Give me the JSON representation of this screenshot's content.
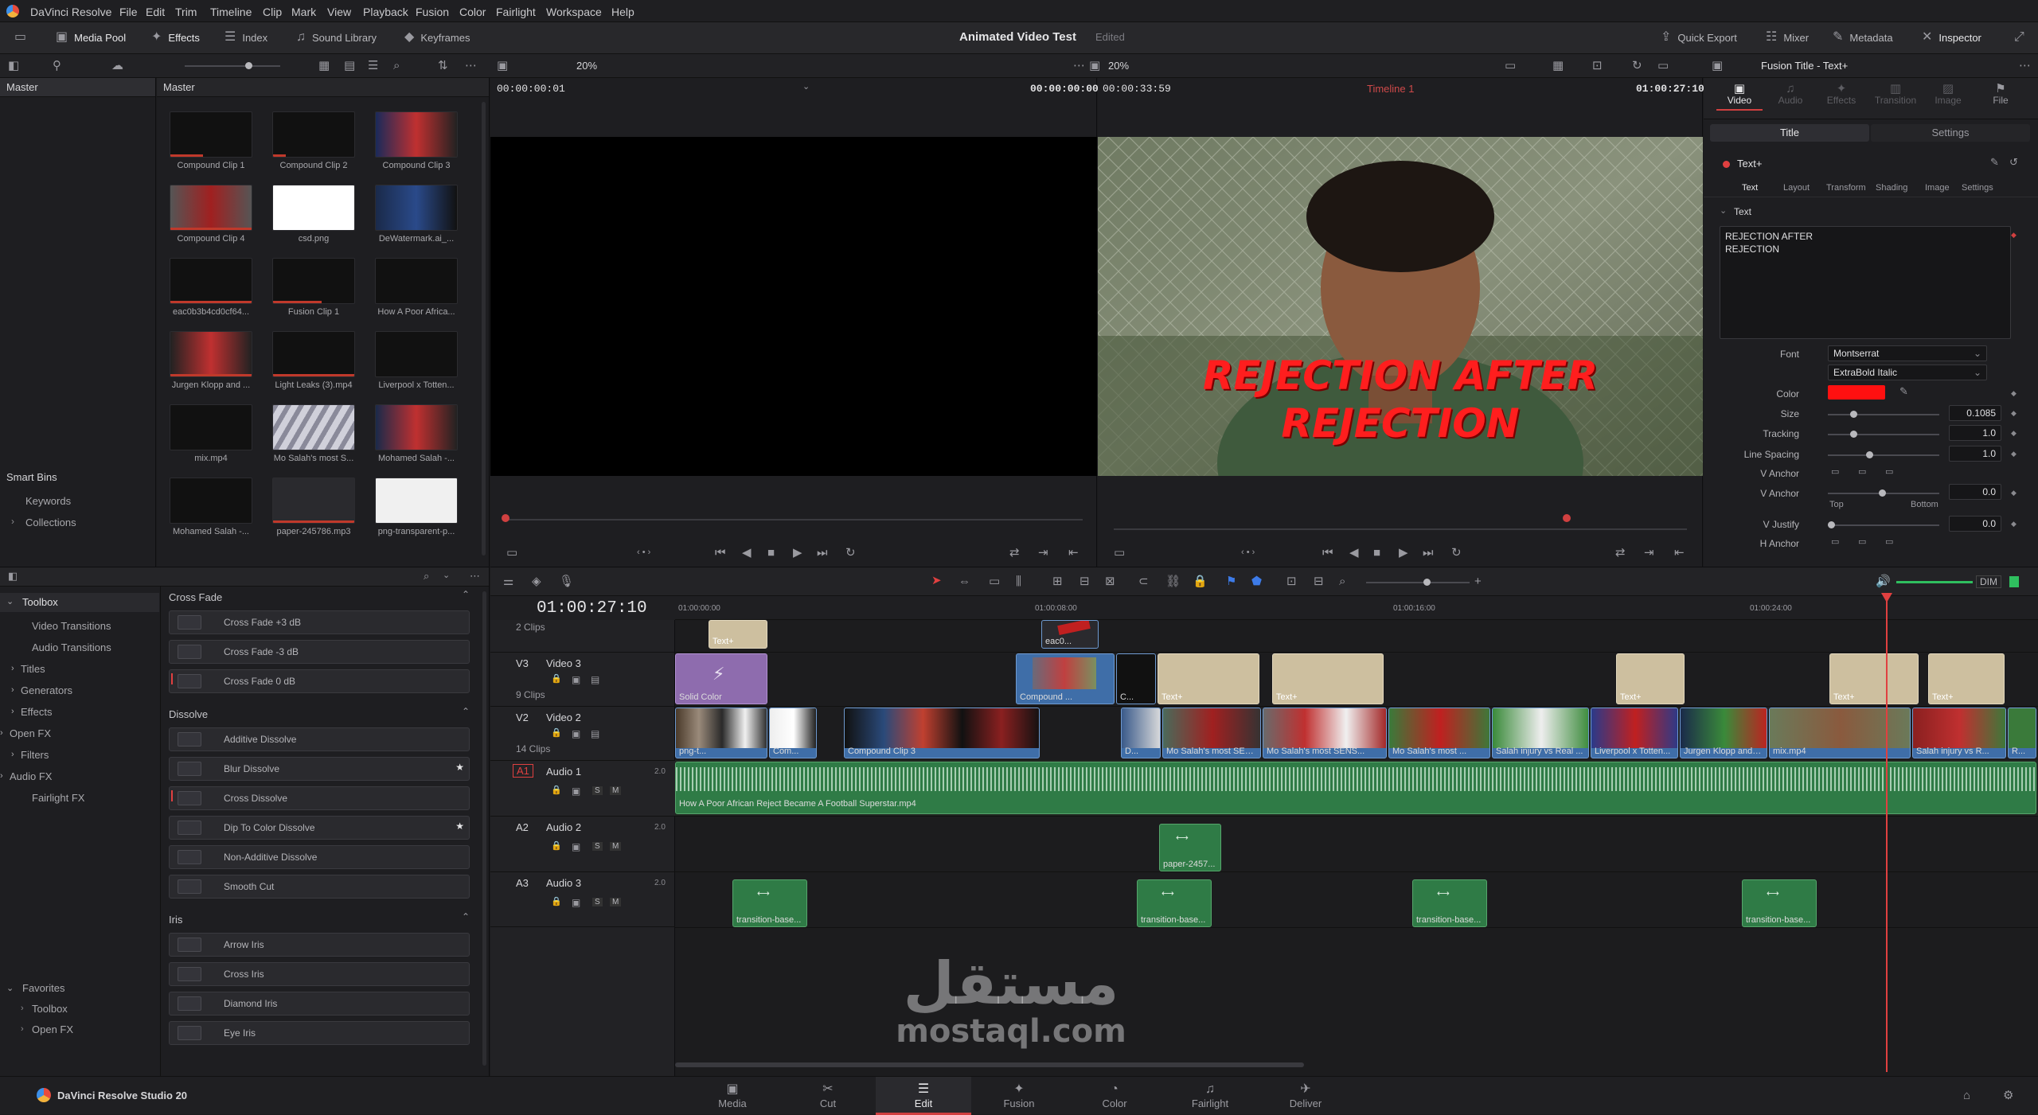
{
  "menu": {
    "app": "DaVinci Resolve",
    "items": [
      "File",
      "Edit",
      "Trim",
      "Timeline",
      "Clip",
      "Mark",
      "View",
      "Playback",
      "Fusion",
      "Color",
      "Fairlight",
      "Workspace",
      "Help"
    ]
  },
  "toolbar": {
    "media_pool": "Media Pool",
    "effects": "Effects",
    "index": "Index",
    "sound_library": "Sound Library",
    "keyframes": "Keyframes",
    "project_title": "Animated Video Test",
    "project_status": "Edited",
    "quick_export": "Quick Export",
    "mixer": "Mixer",
    "metadata": "Metadata",
    "inspector": "Inspector"
  },
  "subbar": {
    "zoom_left": "20%",
    "zoom_right": "20%",
    "inspector_title": "Fusion Title - Text+"
  },
  "bins": {
    "master_left": "Master",
    "master_right": "Master",
    "smart_bins": "Smart Bins",
    "keywords": "Keywords",
    "collections": "Collections"
  },
  "media_pool": {
    "clips": [
      "Compound Clip 1",
      "Compound Clip 2",
      "Compound Clip 3",
      "Compound Clip 4",
      "csd.png",
      "DeWatermark.ai_...",
      "eac0b3b4cd0cf64...",
      "Fusion Clip 1",
      "How A Poor Africa...",
      "Jurgen Klopp and ...",
      "Light Leaks (3).mp4",
      "Liverpool x Totten...",
      "mix.mp4",
      "Mo Salah's most S...",
      "Mohamed Salah -...",
      "Mohamed Salah -...",
      "paper-245786.mp3",
      "png-transparent-p..."
    ]
  },
  "source_viewer": {
    "timecode_left": "00:00:00:01",
    "timecode_right": "00:00:00:00"
  },
  "timeline_viewer": {
    "timecode_left": "00:00:33:59",
    "timeline_name": "Timeline 1",
    "timecode_right": "01:00:27:10",
    "title_line1": "REJECTION AFTER",
    "title_line2": "REJECTION"
  },
  "inspector": {
    "tabs": [
      "Video",
      "Audio",
      "Effects",
      "Transition",
      "Image",
      "File"
    ],
    "subtabs": [
      "Title",
      "Settings"
    ],
    "node": "Text+",
    "text_tabs": [
      "Text",
      "Layout",
      "Transform",
      "Shading",
      "Image",
      "Settings"
    ],
    "section": "Text",
    "text_value_line1": "REJECTION AFTER",
    "text_value_line2": "REJECTION",
    "font_label": "Font",
    "font": "Montserrat",
    "style": "ExtraBold Italic",
    "color_label": "Color",
    "color": "#ff1010",
    "size_label": "Size",
    "size": "0.1085",
    "tracking_label": "Tracking",
    "tracking": "1.0",
    "line_spacing_label": "Line Spacing",
    "line_spacing": "1.0",
    "v_anchor_label": "V Anchor",
    "v_anchor2_label": "V Anchor",
    "v_anchor_value": "0.0",
    "top_label": "Top",
    "bottom_label": "Bottom",
    "v_justify_label": "V Justify",
    "v_justify_value": "0.0",
    "h_anchor_label": "H Anchor"
  },
  "effects": {
    "toolbox": "Toolbox",
    "tree": [
      "Video Transitions",
      "Audio Transitions",
      "Titles",
      "Generators",
      "Effects",
      "Open FX",
      "Filters",
      "Audio FX",
      "Fairlight FX"
    ],
    "favorites": "Favorites",
    "fav_items": [
      "Toolbox",
      "Open FX"
    ],
    "sections": [
      {
        "title": "Cross Fade",
        "items": [
          "Cross Fade +3 dB",
          "Cross Fade -3 dB",
          "Cross Fade 0 dB"
        ]
      },
      {
        "title": "Dissolve",
        "items": [
          "Additive Dissolve",
          "Blur Dissolve",
          "Cross Dissolve",
          "Dip To Color Dissolve",
          "Non-Additive Dissolve",
          "Smooth Cut"
        ]
      },
      {
        "title": "Iris",
        "items": [
          "Arrow Iris",
          "Cross Iris",
          "Diamond Iris",
          "Eye Iris"
        ]
      }
    ]
  },
  "timeline": {
    "timecode": "01:00:27:10",
    "ruler": [
      "01:00:00:00",
      "01:00:08:00",
      "01:00:16:00",
      "01:00:24:00"
    ],
    "dim": "DIM",
    "v4_clips": "2 Clips",
    "tracks": [
      {
        "id": "V3",
        "name": "Video 3",
        "count": "9 Clips"
      },
      {
        "id": "V2",
        "name": "Video 2",
        "count": "14 Clips"
      },
      {
        "id": "A1",
        "name": "Audio 1",
        "ch": "2.0"
      },
      {
        "id": "A2",
        "name": "Audio 2",
        "ch": "2.0"
      },
      {
        "id": "A3",
        "name": "Audio 3",
        "ch": "2.0"
      }
    ],
    "clip_names": {
      "text": "Text+",
      "eac": "eac0...",
      "solid": "Solid Color",
      "compound_short": "Compound ...",
      "c": "C...",
      "png": "png-t...",
      "com": "Com...",
      "compound3": "Compound Clip 3",
      "d": "D...",
      "mo1": "Mo Salah's most SEN...",
      "mo2": "Mo Salah's most SENS...",
      "mo3": "Mo Salah's most ...",
      "salah_real": "Salah injury vs Real ...",
      "liv_tot": "Liverpool x Totten...",
      "klopp": "Jurgen Klopp and L...",
      "mix": "mix.mp4",
      "salah_r": "Salah injury vs R...",
      "r": "R...",
      "audio1": "How A Poor African Reject Became A Football Superstar.mp4",
      "paper": "paper-2457...",
      "trans": "transition-base..."
    }
  },
  "pages": [
    "Media",
    "Cut",
    "Edit",
    "Fusion",
    "Color",
    "Fairlight",
    "Deliver"
  ],
  "footer_app": "DaVinci Resolve Studio 20",
  "watermark_ar": "مستقل",
  "watermark_en": "mostaql.com"
}
